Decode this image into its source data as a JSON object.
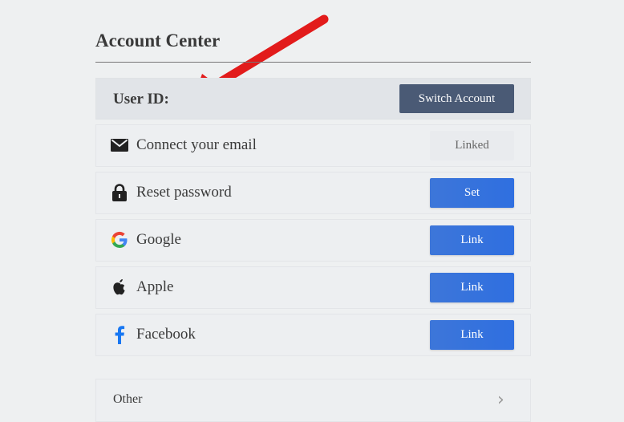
{
  "page": {
    "title": "Account Center",
    "user_id_label": "User ID:",
    "switch_account": "Switch Account"
  },
  "rows": [
    {
      "label": "Connect your email",
      "action": "Linked",
      "icon": "email-icon"
    },
    {
      "label": "Reset password",
      "action": "Set",
      "icon": "lock-icon"
    },
    {
      "label": "Google",
      "action": "Link",
      "icon": "google-icon"
    },
    {
      "label": "Apple",
      "action": "Link",
      "icon": "apple-icon"
    },
    {
      "label": "Facebook",
      "action": "Link",
      "icon": "facebook-icon"
    }
  ],
  "other": {
    "label": "Other",
    "chevron": "›"
  },
  "colors": {
    "accent_blue": "#3d76d9",
    "dark_button": "#4a5a75",
    "arrow_red": "#e21b1b"
  }
}
